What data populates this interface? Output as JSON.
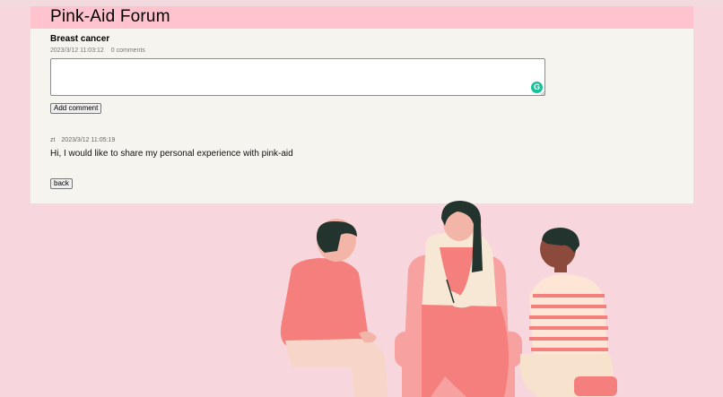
{
  "header": {
    "title": "Pink-Aid Forum"
  },
  "post": {
    "title": "Breast cancer",
    "date": "2023/3/12 11:03:12",
    "comments_count": "0 comments"
  },
  "comment_form": {
    "value": "",
    "placeholder": "",
    "add_button_label": "Add comment",
    "grammar_icon": "grammarly-icon"
  },
  "comments": [
    {
      "author": "zt",
      "date": "2023/3/12 11:05:19",
      "text": "Hi, I would like to share my personal experience with pink-aid"
    }
  ],
  "back_button_label": "back",
  "colors": {
    "page_bg": "#f7d7dd",
    "header_bg": "#ffc3cd",
    "card_bg": "#f5f4ee",
    "accent_salmon": "#f57f7c",
    "grammar_green": "#15c39a"
  }
}
